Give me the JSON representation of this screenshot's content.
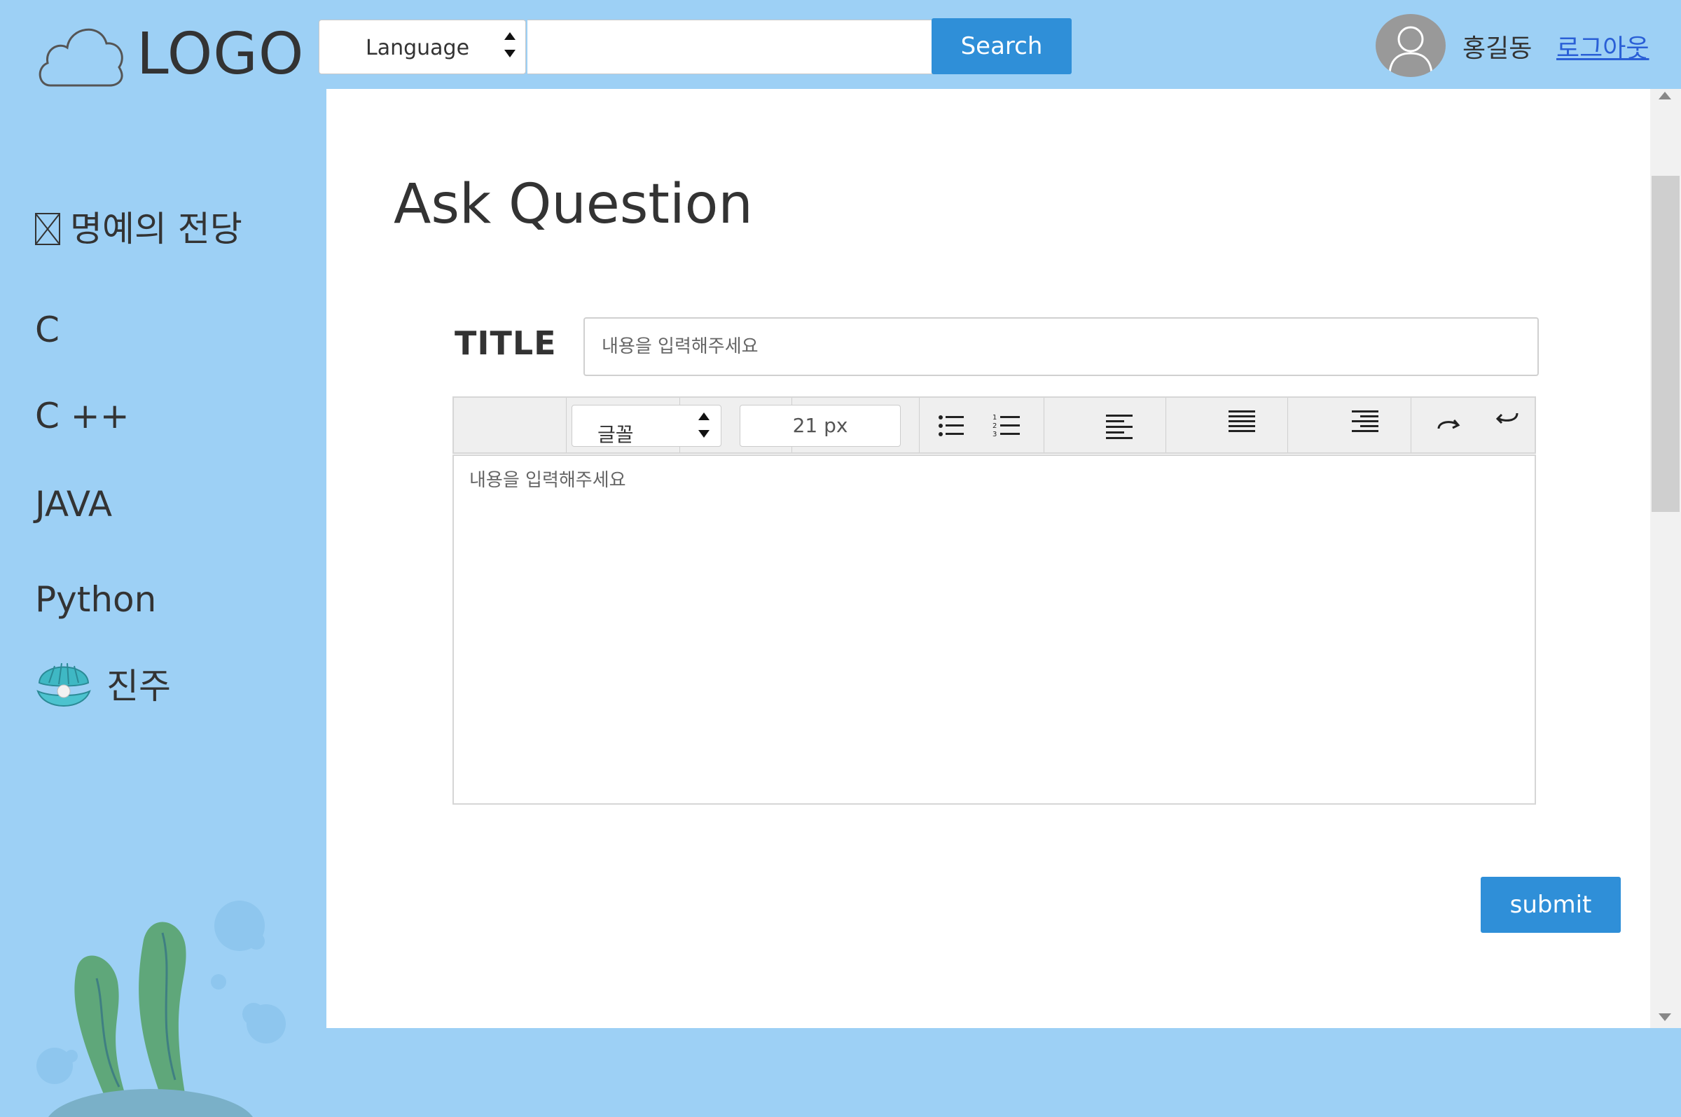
{
  "header": {
    "logo_text": "LOGO",
    "language_select": {
      "selected": "Language"
    },
    "search": {
      "placeholder": "",
      "button_label": "Search"
    },
    "user": {
      "name": "홍길동",
      "logout_label": "로그아웃"
    }
  },
  "sidebar": {
    "items": [
      {
        "label": "명예의 전당",
        "icon": "broken-image-icon"
      },
      {
        "label": "C"
      },
      {
        "label": "C ++"
      },
      {
        "label": "JAVA"
      },
      {
        "label": "Python"
      },
      {
        "label": "진주",
        "icon": "pearl-shell-icon"
      }
    ]
  },
  "main": {
    "page_title": "Ask Question",
    "title_label": "TITLE",
    "title_placeholder": "내용을 입력해주세요",
    "toolbar": {
      "font_select": "글꼴",
      "font_size": "21 px",
      "buttons": [
        "bullet-list-icon",
        "numbered-list-icon",
        "align-left-icon",
        "align-justify-icon",
        "align-right-icon",
        "redo-icon",
        "undo-icon"
      ]
    },
    "editor_placeholder": "내용을 입력해주세요",
    "submit_label": "submit"
  },
  "colors": {
    "background": "#9dd0f5",
    "button": "#2f8fd8",
    "link": "#2a5fd6"
  }
}
